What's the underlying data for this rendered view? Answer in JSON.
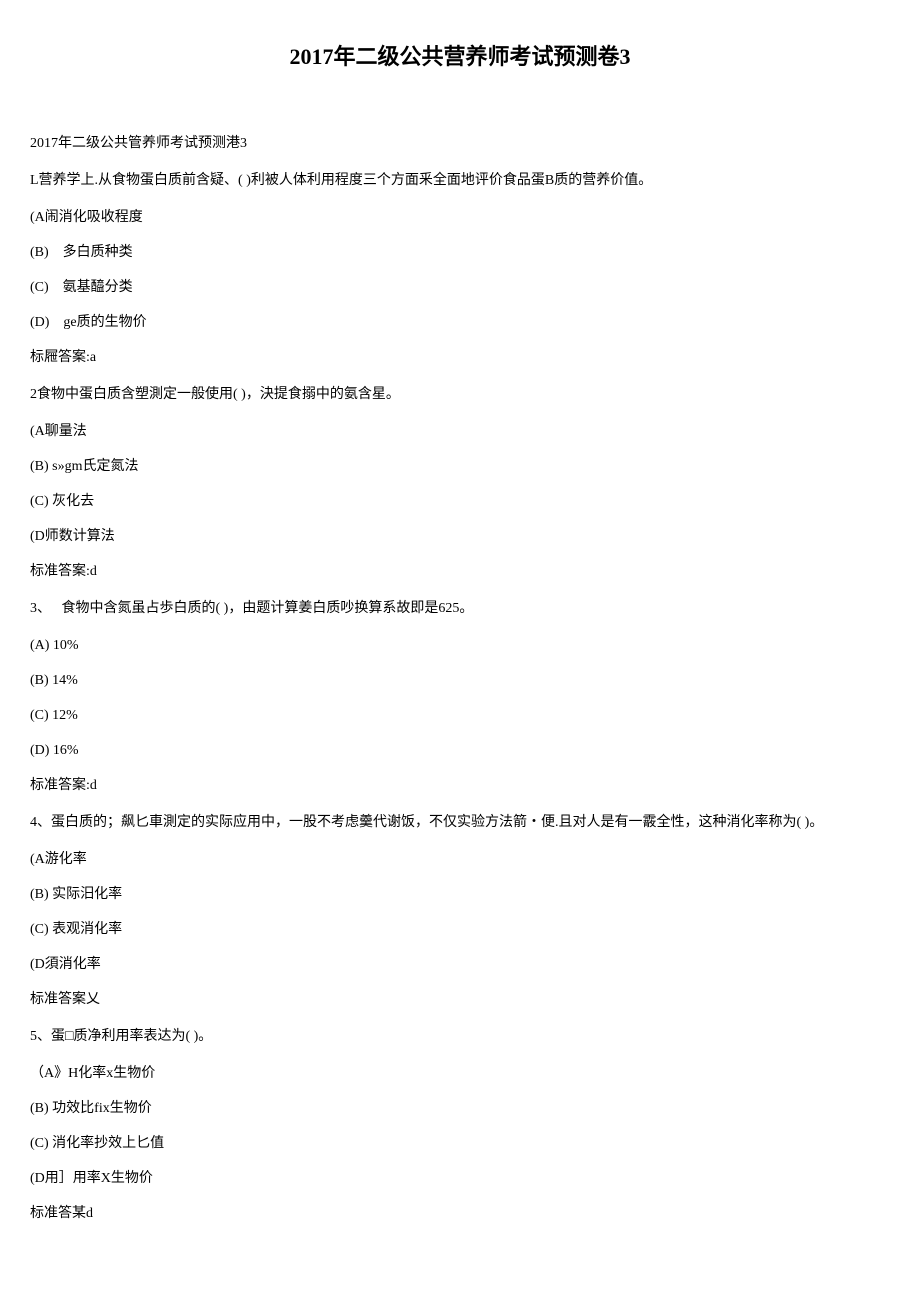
{
  "title": "2017年二级公共营养师考试预测卷3",
  "intro1": "2017年二级公共管养师考试预测港3",
  "q1": {
    "text": "L营养学上.从食物蛋白质前含疑、( )利被人体利用程度三个方面釆全面地评价食品蛋B质的营养价值。",
    "optA": "(A闹消化吸收程度",
    "optB": "(B)　多白质种类",
    "optC": "(C)　氨基醯分类",
    "optD": "(D)　ge质的生物价",
    "answer": "标屜答案:a"
  },
  "q2": {
    "text": "2食物中蛋白质含塑測定一般使用( )，決提食搦中的氨含星。",
    "optA": "(A聊量法",
    "optB": "(B)  s»gm氏定氮法",
    "optC": "(C)   灰化去",
    "optD": "(D师数计算法",
    "answer": "标准答案:d"
  },
  "q3": {
    "text": "3、　  食物中含氮虽占歩白质的( )，由题计算姜白质吵换算系故即是625。",
    "optA": "(A)   10%",
    "optB": "(B)   14%",
    "optC": "(C)   12%",
    "optD": "(D)   16%",
    "answer": "标准答案:d"
  },
  "q4": {
    "text": "4、蛋白质的；飙匕車測定的实际应用中，一股不考虑羹代谢饭，不仅实验方法箭・便.且对人是有一霰全性，这种消化率称为( )。",
    "optA": "(A游化率",
    "optB": "(B)   实际汨化率",
    "optC": "(C)   表观消化率",
    "optD": "(D須消化率",
    "answer": "标准答案乂"
  },
  "q5": {
    "text": "5、蛋□质净利用率表达为( )。",
    "optA": "（A》H化率x生物价",
    "optB": "(B)   功效比fix生物价",
    "optC": "(C)   消化率抄效上匕值",
    "optD": "(D用］用率X生物价",
    "answer": "标准答某d"
  }
}
